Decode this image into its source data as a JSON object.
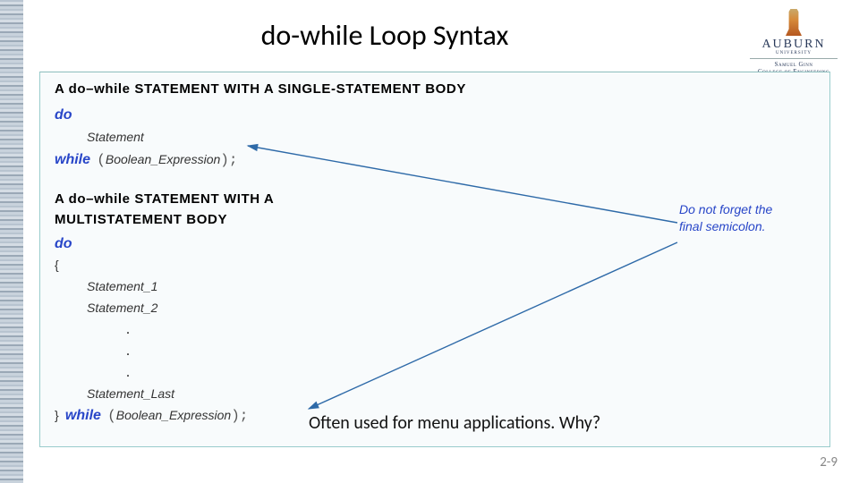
{
  "title": "do-while Loop Syntax",
  "logo": {
    "name": "AUBURN",
    "university": "UNIVERSITY",
    "college_line1": "Samuel Ginn",
    "college_line2": "College of Engineering"
  },
  "headings": {
    "single": "A do–while STATEMENT WITH A SINGLE-STATEMENT BODY",
    "multi_l1": "A do–while STATEMENT WITH A",
    "multi_l2": "MULTISTATEMENT BODY"
  },
  "code": {
    "kw_do": "do",
    "kw_while": "while",
    "stmt": "Statement",
    "stmt1": "Statement_1",
    "stmt2": "Statement_2",
    "stmt_last": "Statement_Last",
    "dot": ".",
    "brace_open": "{",
    "brace_close": "}",
    "paren_open": "(",
    "paren_close_semi": ");",
    "bool_expr": "Boolean_Expression"
  },
  "note": "Do not forget the final semicolon.",
  "caption": "Often used for menu applications. Why?",
  "pagenum": "2-9"
}
